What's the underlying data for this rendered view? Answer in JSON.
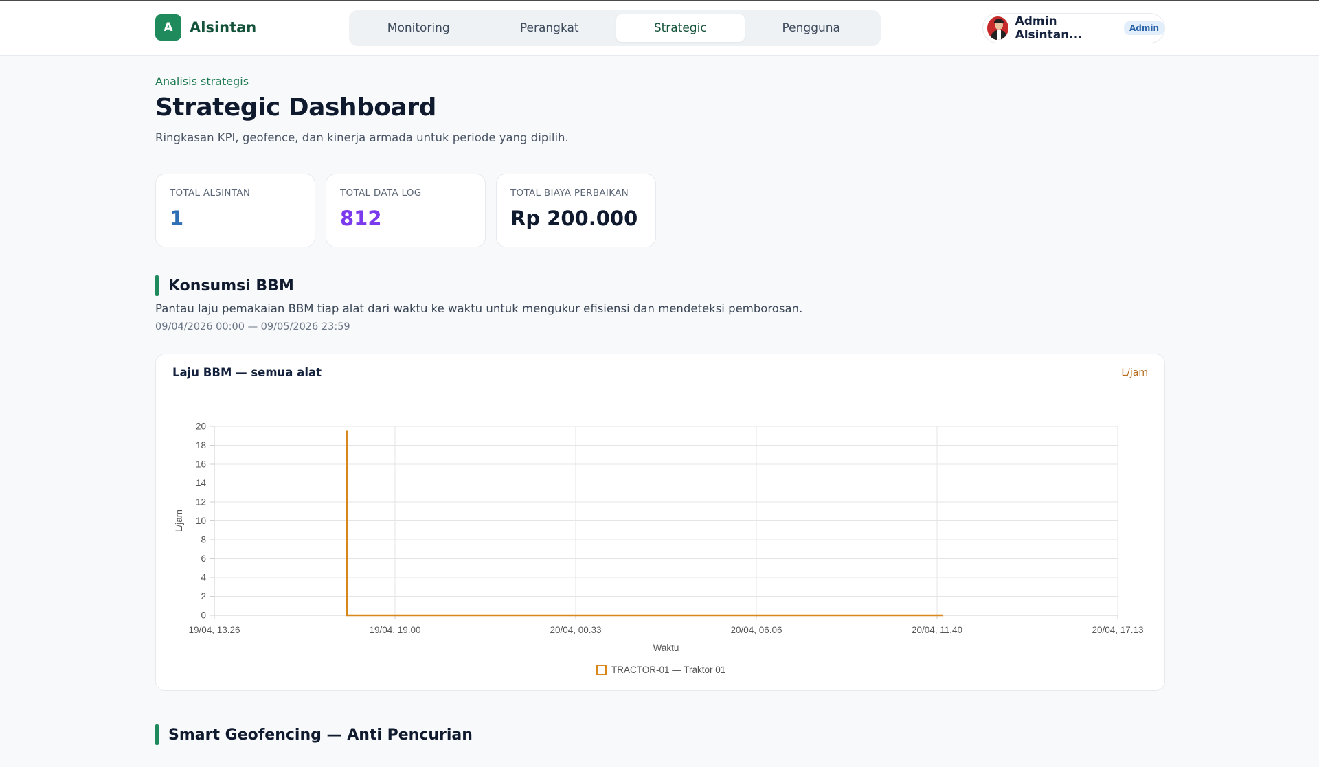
{
  "brand": {
    "mark": "A",
    "name": "Alsintan"
  },
  "nav": {
    "tabs": [
      {
        "label": "Monitoring",
        "active": false
      },
      {
        "label": "Perangkat",
        "active": false
      },
      {
        "label": "Strategic",
        "active": true
      },
      {
        "label": "Pengguna",
        "active": false
      }
    ]
  },
  "user": {
    "name": "Admin Alsintan...",
    "role": "Admin"
  },
  "header": {
    "eyebrow": "Analisis strategis",
    "title": "Strategic Dashboard",
    "subtitle": "Ringkasan KPI, geofence, dan kinerja armada untuk periode yang dipilih."
  },
  "kpis": [
    {
      "label": "TOTAL ALSINTAN",
      "value": "1",
      "color": "#2f6fb3"
    },
    {
      "label": "TOTAL DATA LOG",
      "value": "812",
      "color": "#7c3aed"
    },
    {
      "label": "TOTAL BIAYA PERBAIKAN",
      "value": "Rp 200.000",
      "color": "#101a2e"
    }
  ],
  "fuel_section": {
    "title": "Konsumsi BBM",
    "description": "Pantau laju pemakaian BBM tiap alat dari waktu ke waktu untuk mengukur efisiensi dan mendeteksi pemborosan.",
    "range": "09/04/2026 00:00 — 09/05/2026 23:59",
    "card_title": "Laju BBM — semua alat",
    "card_unit": "L/jam"
  },
  "geofence_section": {
    "title": "Smart Geofencing — Anti Pencurian"
  },
  "colors": {
    "accent": "#1f8a5b",
    "series": "#d9861a"
  },
  "chart_data": {
    "type": "line",
    "title": "",
    "xlabel": "Waktu",
    "ylabel": "L/jam",
    "x_ticks": [
      "19/04, 13.26",
      "19/04, 19.00",
      "20/04, 00.33",
      "20/04, 06.06",
      "20/04, 11.40",
      "20/04, 17.13"
    ],
    "y_ticks": [
      0,
      2,
      4,
      6,
      8,
      10,
      12,
      14,
      16,
      18,
      20
    ],
    "ylim": [
      0,
      20
    ],
    "xlim_hours": [
      0,
      27.78
    ],
    "grid": true,
    "legend_position": "bottom-center",
    "series": [
      {
        "name": "TRACTOR-01 — Traktor 01",
        "color": "#d9861a",
        "points": [
          {
            "x_hours": 4.07,
            "y": 19.6
          },
          {
            "x_hours": 4.08,
            "y": 0
          },
          {
            "x_hours": 22.4,
            "y": 0
          }
        ]
      }
    ]
  }
}
